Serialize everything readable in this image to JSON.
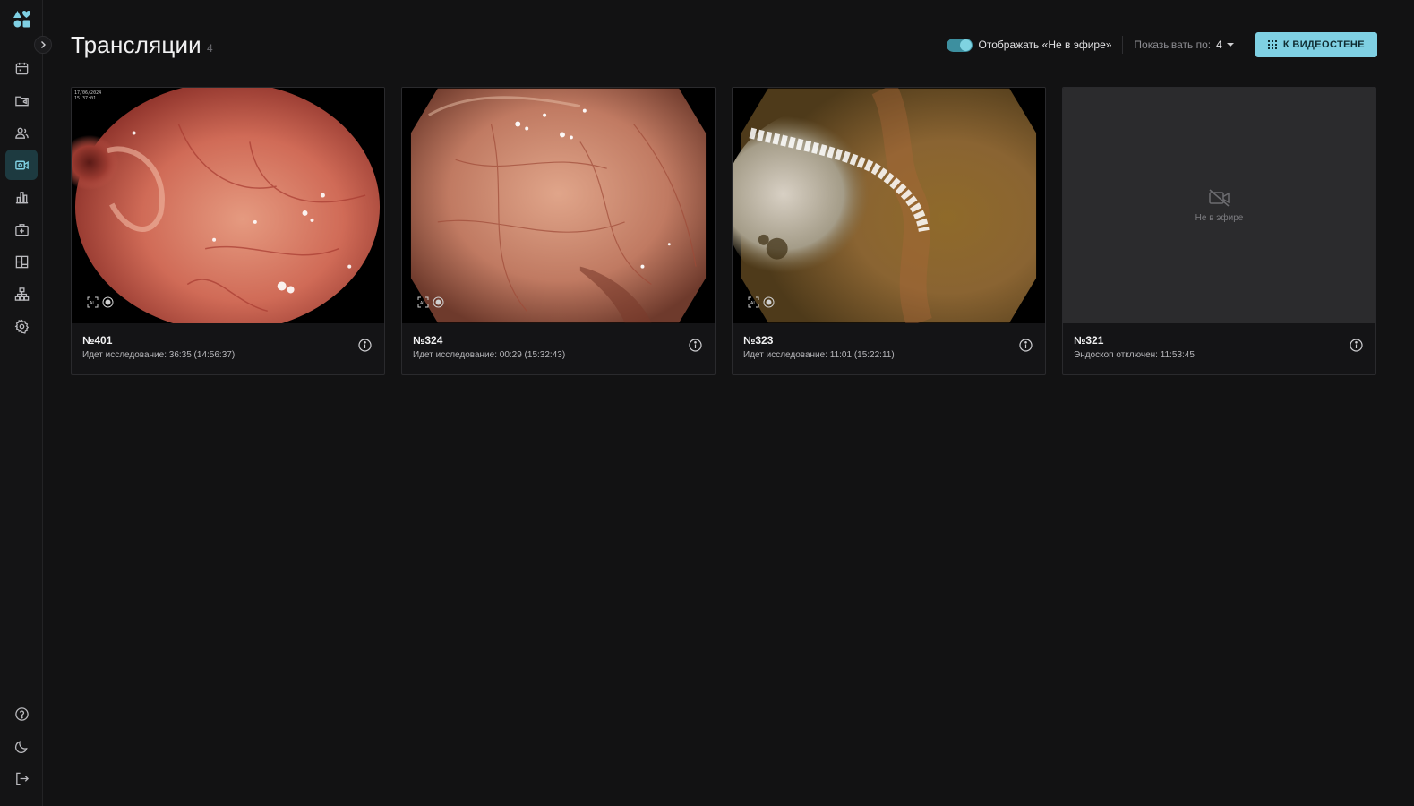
{
  "page": {
    "title": "Трансляции",
    "count": "4"
  },
  "toolbar": {
    "toggle_label": "Отображать «Не в эфире»",
    "show_by_label": "Показывать по:",
    "show_by_value": "4",
    "wall_button": "К ВИДЕОСТЕНЕ"
  },
  "sidebar": {
    "top_items": [
      {
        "icon": "calendar-icon"
      },
      {
        "icon": "folder-icon"
      },
      {
        "icon": "users-icon"
      },
      {
        "icon": "video-icon",
        "active": true
      },
      {
        "icon": "chart-icon"
      },
      {
        "icon": "medkit-icon"
      },
      {
        "icon": "layout-icon"
      },
      {
        "icon": "hierarchy-icon"
      },
      {
        "icon": "gear-icon"
      }
    ],
    "bottom_items": [
      {
        "icon": "help-icon"
      },
      {
        "icon": "moon-icon"
      },
      {
        "icon": "logout-icon"
      }
    ]
  },
  "cards": [
    {
      "title": "№401",
      "status": "Идет исследование: 36:35 (14:56:37)",
      "live": true,
      "overlay_date": "17/06/2024",
      "overlay_time": "15:37:01"
    },
    {
      "title": "№324",
      "status": "Идет исследование: 00:29 (15:32:43)",
      "live": true
    },
    {
      "title": "№323",
      "status": "Идет исследование: 11:01 (15:22:11)",
      "live": true
    },
    {
      "title": "№321",
      "status": "Эндоскоп отключен: 11:53:45",
      "live": false,
      "offline_text": "Не в эфире"
    }
  ],
  "colors": {
    "accent": "#7fd0e3",
    "background": "#121213",
    "card_bg": "#141416"
  }
}
